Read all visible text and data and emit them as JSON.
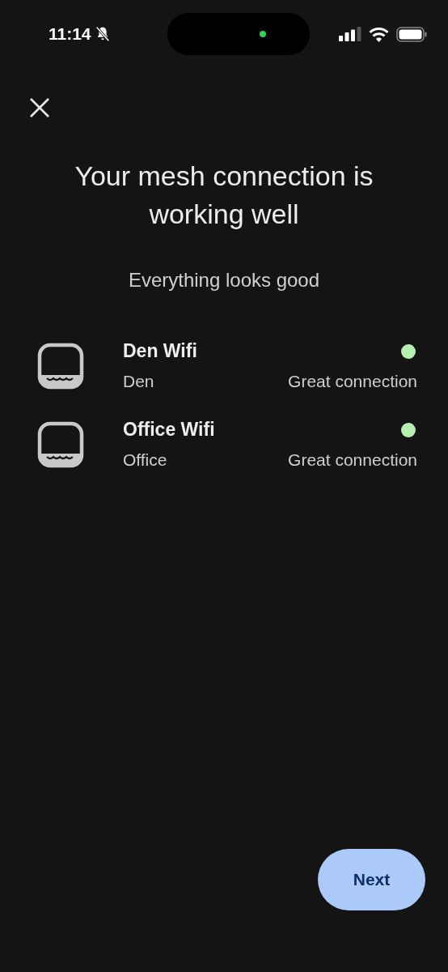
{
  "status_bar": {
    "time": "11:14"
  },
  "title": "Your mesh connection is working well",
  "subtitle": "Everything looks good",
  "devices": [
    {
      "name": "Den Wifi",
      "room": "Den",
      "status": "Great connection",
      "color": "#b5f0b0"
    },
    {
      "name": "Office Wifi",
      "room": "Office",
      "status": "Great connection",
      "color": "#b5f0b0"
    }
  ],
  "next_button": "Next"
}
